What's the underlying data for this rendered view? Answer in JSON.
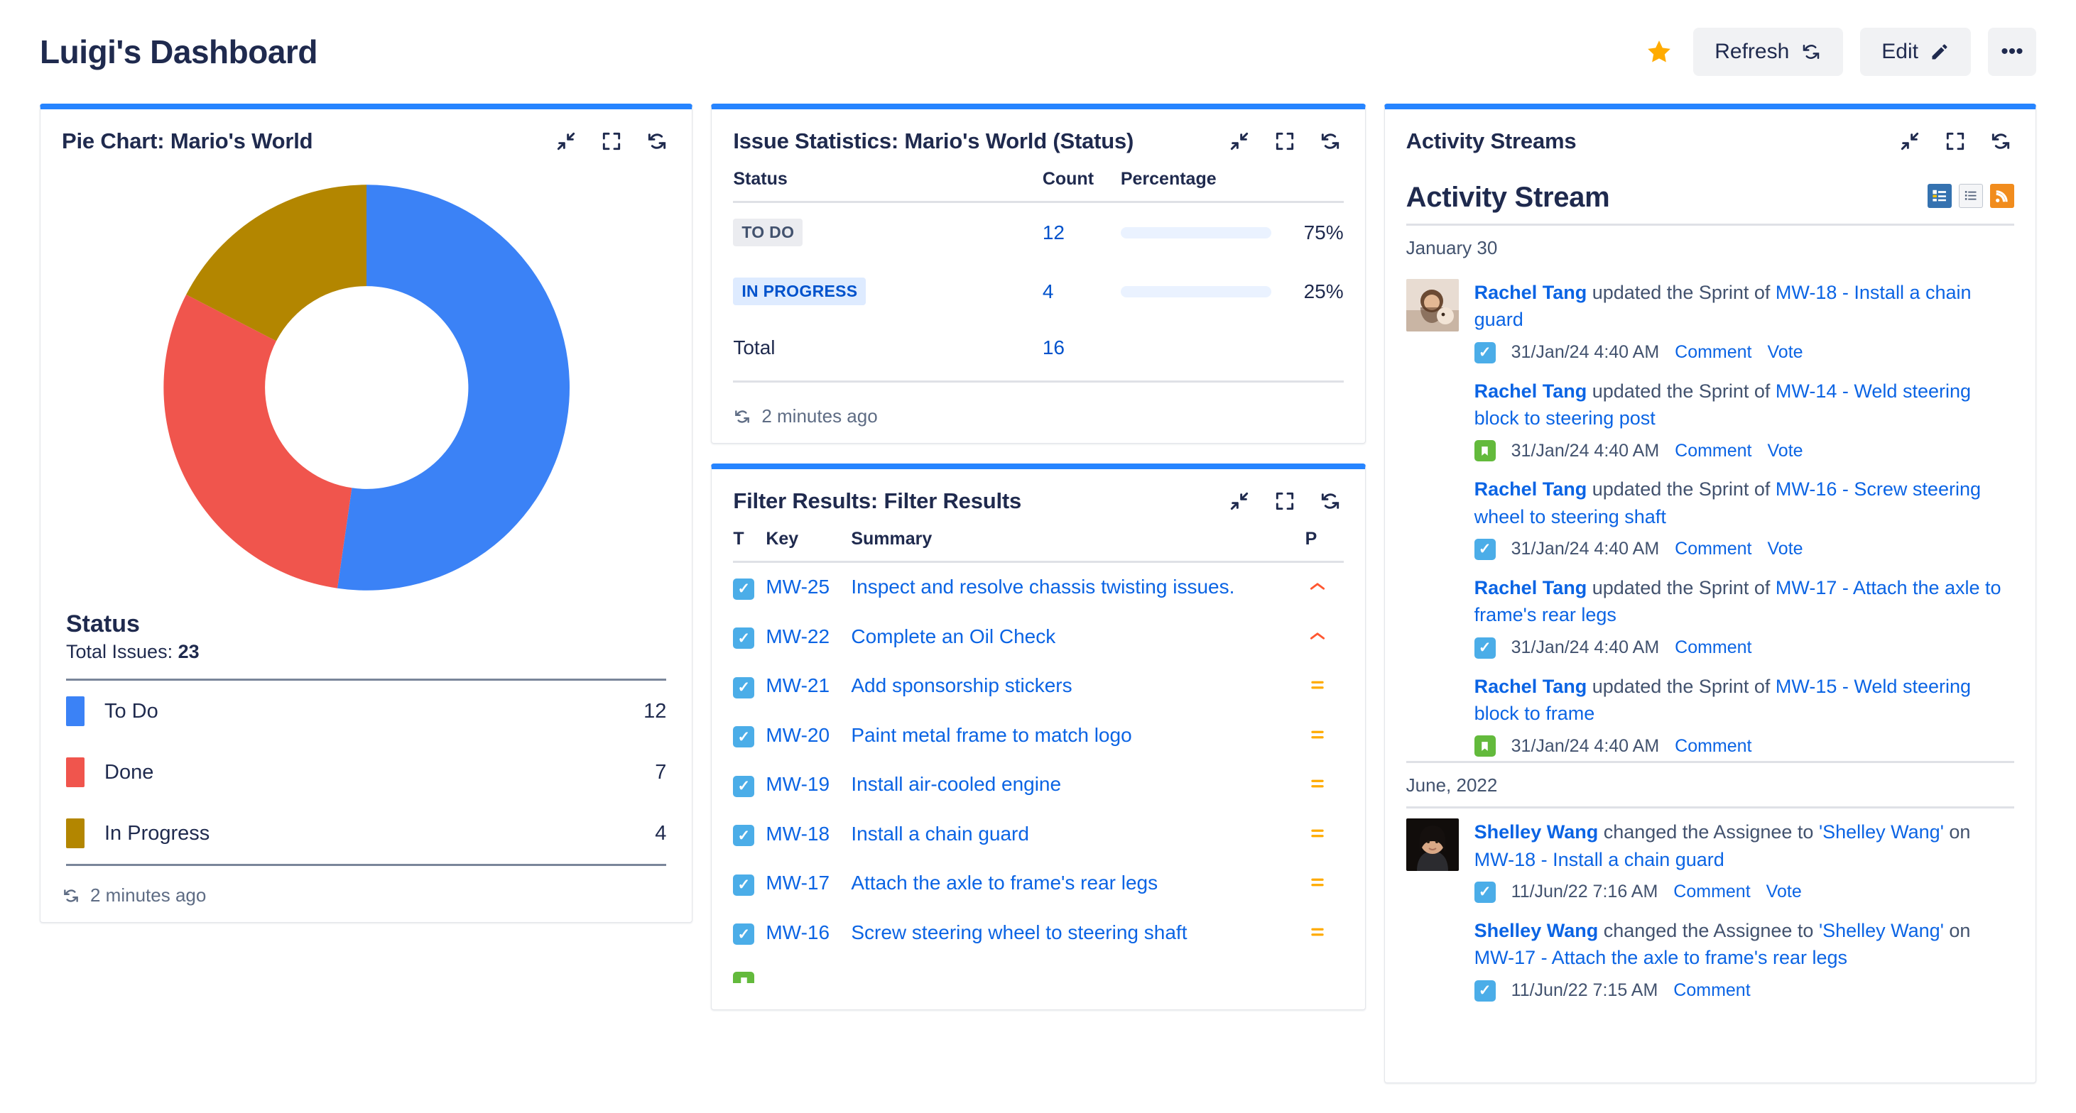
{
  "header": {
    "title": "Luigi's Dashboard",
    "star_icon": "star-icon",
    "refresh_label": "Refresh",
    "edit_label": "Edit",
    "more_label": "•••"
  },
  "panels": {
    "pie": {
      "title": "Pie Chart: Mario's World",
      "footer": "2 minutes ago",
      "legend_title": "Status",
      "total_label": "Total Issues:",
      "total_value": "23"
    },
    "stats": {
      "title": "Issue Statistics: Mario's World (Status)",
      "footer": "2 minutes ago",
      "columns": {
        "status": "Status",
        "count": "Count",
        "percentage": "Percentage"
      },
      "total_label": "Total",
      "total_value": "16",
      "rows": [
        {
          "status": "TO DO",
          "badge": "todo",
          "count": "12",
          "percent": "75%",
          "percent_value": 75
        },
        {
          "status": "IN PROGRESS",
          "badge": "inprogress",
          "count": "4",
          "percent": "25%",
          "percent_value": 25
        }
      ]
    },
    "filter": {
      "title": "Filter Results: Filter Results",
      "columns": {
        "type": "T",
        "key": "Key",
        "summary": "Summary",
        "priority": "P"
      },
      "rows": [
        {
          "type": "task",
          "key": "MW-25",
          "summary": "Inspect and resolve chassis twisting issues.",
          "priority": "high"
        },
        {
          "type": "task",
          "key": "MW-22",
          "summary": "Complete an Oil Check",
          "priority": "high"
        },
        {
          "type": "task",
          "key": "MW-21",
          "summary": "Add sponsorship stickers",
          "priority": "medium"
        },
        {
          "type": "task",
          "key": "MW-20",
          "summary": "Paint metal frame to match logo",
          "priority": "medium"
        },
        {
          "type": "task",
          "key": "MW-19",
          "summary": "Install air-cooled engine",
          "priority": "medium"
        },
        {
          "type": "task",
          "key": "MW-18",
          "summary": "Install a chain guard",
          "priority": "medium"
        },
        {
          "type": "task",
          "key": "MW-17",
          "summary": "Attach the axle to frame's rear legs",
          "priority": "medium"
        },
        {
          "type": "task",
          "key": "MW-16",
          "summary": "Screw steering wheel to steering shaft",
          "priority": "medium"
        }
      ]
    },
    "activity": {
      "title": "Activity Streams",
      "stream_title": "Activity Stream",
      "view_icons": [
        "list-view-icon",
        "detail-view-icon",
        "rss-icon"
      ],
      "groups": [
        {
          "date": "January 30",
          "entries": [
            {
              "user": "Rachel Tang",
              "action": "updated the Sprint of",
              "issue": "MW-18 - Install a chain guard",
              "issue_type": "task",
              "time": "31/Jan/24 4:40 AM",
              "actions": [
                "Comment",
                "Vote"
              ],
              "avatar": "rachel"
            },
            {
              "user": "Rachel Tang",
              "action": "updated the Sprint of",
              "issue": "MW-14 - Weld steering block to steering post",
              "issue_type": "story",
              "time": "31/Jan/24 4:40 AM",
              "actions": [
                "Comment",
                "Vote"
              ],
              "avatar": null
            },
            {
              "user": "Rachel Tang",
              "action": "updated the Sprint of",
              "issue": "MW-16 - Screw steering wheel to steering shaft",
              "issue_type": "task",
              "time": "31/Jan/24 4:40 AM",
              "actions": [
                "Comment",
                "Vote"
              ],
              "avatar": null
            },
            {
              "user": "Rachel Tang",
              "action": "updated the Sprint of",
              "issue": "MW-17 - Attach the axle to frame's rear legs",
              "issue_type": "task",
              "time": "31/Jan/24 4:40 AM",
              "actions": [
                "Comment"
              ],
              "avatar": null
            },
            {
              "user": "Rachel Tang",
              "action": "updated the Sprint of",
              "issue": "MW-15 - Weld steering block to frame",
              "issue_type": "story",
              "time": "31/Jan/24 4:40 AM",
              "actions": [
                "Comment"
              ],
              "avatar": null
            }
          ]
        },
        {
          "date": "June, 2022",
          "entries": [
            {
              "user": "Shelley Wang",
              "action": "changed the Assignee to",
              "assignee": "'Shelley Wang'",
              "connector": "on",
              "issue": "MW-18 - Install a chain guard",
              "issue_type": "task",
              "time": "11/Jun/22 7:16 AM",
              "actions": [
                "Comment",
                "Vote"
              ],
              "avatar": "shelley"
            },
            {
              "user": "Shelley Wang",
              "action": "changed the Assignee to",
              "assignee": "'Shelley Wang'",
              "connector": "on",
              "issue": "MW-17 - Attach the axle to frame's rear legs",
              "issue_type": "task",
              "time": "11/Jun/22 7:15 AM",
              "actions": [
                "Comment"
              ],
              "avatar": null
            }
          ]
        }
      ]
    }
  },
  "colors": {
    "accent": "#2684FF",
    "link": "#0B64E4",
    "todo": "#3B82F6",
    "done": "#F0554D",
    "inprogress": "#B38600",
    "star": "#FFAB00",
    "priority_high": "#FF5630",
    "priority_medium": "#FFAB00"
  },
  "chart_data": {
    "type": "pie",
    "title": "Status",
    "subtitle": "Total Issues: 23",
    "categories": [
      "To Do",
      "Done",
      "In Progress"
    ],
    "values": [
      12,
      7,
      4
    ],
    "colors": [
      "#3B82F6",
      "#F0554D",
      "#B38600"
    ],
    "total": 23,
    "donut": true,
    "legend_position": "bottom",
    "start_angle": 0,
    "direction": "clockwise"
  }
}
